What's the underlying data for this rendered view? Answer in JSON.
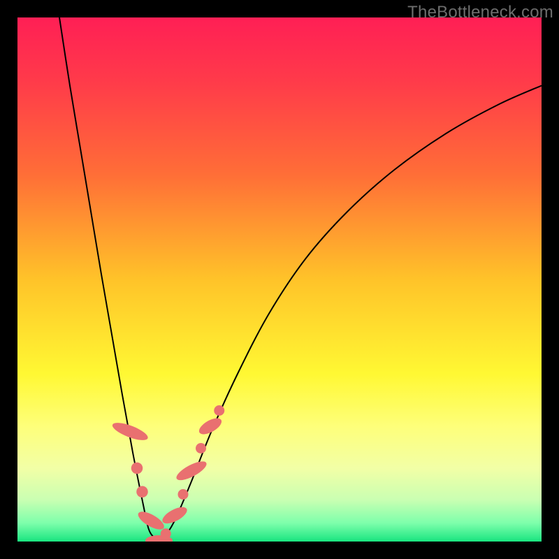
{
  "watermark": "TheBottleneck.com",
  "chart_data": {
    "type": "line",
    "title": "",
    "xlabel": "",
    "ylabel": "",
    "xlim": [
      0,
      100
    ],
    "ylim": [
      0,
      100
    ],
    "grid": false,
    "legend": false,
    "background": {
      "type": "vertical-gradient",
      "stops": [
        {
          "pos": 0.0,
          "color": "#ff1f55"
        },
        {
          "pos": 0.12,
          "color": "#ff3a4a"
        },
        {
          "pos": 0.3,
          "color": "#ff6e37"
        },
        {
          "pos": 0.5,
          "color": "#ffc329"
        },
        {
          "pos": 0.68,
          "color": "#fff833"
        },
        {
          "pos": 0.78,
          "color": "#feff7a"
        },
        {
          "pos": 0.86,
          "color": "#f2ffa6"
        },
        {
          "pos": 0.92,
          "color": "#caffb2"
        },
        {
          "pos": 0.965,
          "color": "#7dffab"
        },
        {
          "pos": 1.0,
          "color": "#19e580"
        }
      ]
    },
    "series": [
      {
        "name": "left-curve",
        "x": [
          8.0,
          10.0,
          12.0,
          14.0,
          16.0,
          18.0,
          20.0,
          22.0,
          24.0,
          25.0,
          26.0,
          27.0
        ],
        "y": [
          100.0,
          87.0,
          75.0,
          63.0,
          51.0,
          39.5,
          28.0,
          17.0,
          7.0,
          2.5,
          0.8,
          0.0
        ]
      },
      {
        "name": "right-curve",
        "x": [
          27.0,
          28.0,
          30.0,
          33.0,
          37.0,
          42.0,
          48.0,
          55.0,
          63.0,
          72.0,
          82.0,
          92.0,
          100.0
        ],
        "y": [
          0.0,
          0.8,
          4.0,
          11.0,
          21.0,
          32.0,
          43.5,
          54.0,
          63.0,
          71.0,
          78.0,
          83.5,
          87.0
        ]
      }
    ],
    "markers": [
      {
        "name": "left-cluster-upper",
        "type": "pill",
        "cx": 21.5,
        "cy": 21.0,
        "rx": 1.1,
        "ry": 3.6,
        "angle": -69
      },
      {
        "name": "left-dot-1",
        "type": "dot",
        "cx": 22.8,
        "cy": 14.0,
        "r": 1.1
      },
      {
        "name": "left-dot-2",
        "type": "dot",
        "cx": 23.8,
        "cy": 9.5,
        "r": 1.1
      },
      {
        "name": "left-cluster-lower",
        "type": "pill",
        "cx": 25.5,
        "cy": 4.0,
        "rx": 1.1,
        "ry": 2.8,
        "angle": -60
      },
      {
        "name": "bottom-pill",
        "type": "pill",
        "cx": 27.0,
        "cy": 0.2,
        "rx": 2.6,
        "ry": 1.0,
        "angle": 0
      },
      {
        "name": "right-dot-1",
        "type": "dot",
        "cx": 28.3,
        "cy": 1.5,
        "r": 1.0
      },
      {
        "name": "right-cluster-low",
        "type": "pill",
        "cx": 30.0,
        "cy": 5.0,
        "rx": 1.1,
        "ry": 2.6,
        "angle": 62
      },
      {
        "name": "right-dot-2",
        "type": "dot",
        "cx": 31.6,
        "cy": 9.0,
        "r": 1.0
      },
      {
        "name": "right-cluster-mid",
        "type": "pill",
        "cx": 33.2,
        "cy": 13.5,
        "rx": 1.1,
        "ry": 3.2,
        "angle": 62
      },
      {
        "name": "right-dot-3",
        "type": "dot",
        "cx": 35.0,
        "cy": 17.8,
        "r": 1.0
      },
      {
        "name": "right-cluster-up",
        "type": "pill",
        "cx": 36.8,
        "cy": 22.0,
        "rx": 1.1,
        "ry": 2.4,
        "angle": 60
      },
      {
        "name": "right-dot-4",
        "type": "dot",
        "cx": 38.5,
        "cy": 25.0,
        "r": 1.0
      }
    ],
    "colors": {
      "curve": "#000000",
      "marker_fill": "#e97070",
      "marker_stroke": "#e97070"
    }
  }
}
